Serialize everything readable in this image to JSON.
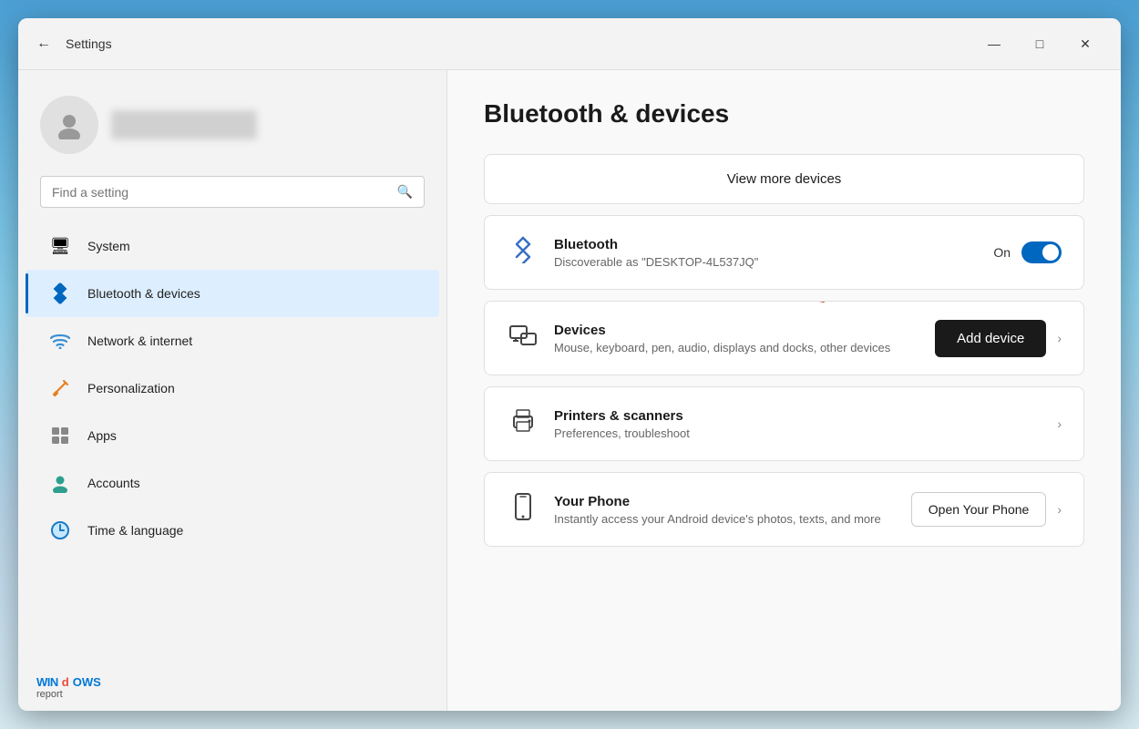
{
  "window": {
    "title": "Settings",
    "controls": {
      "minimize": "—",
      "maximize": "□",
      "close": "✕"
    }
  },
  "sidebar": {
    "search_placeholder": "Find a setting",
    "search_icon": "🔍",
    "nav_items": [
      {
        "id": "system",
        "label": "System",
        "icon": "🖥",
        "active": false
      },
      {
        "id": "bluetooth",
        "label": "Bluetooth & devices",
        "icon": "🔵",
        "active": true
      },
      {
        "id": "network",
        "label": "Network & internet",
        "icon": "📶",
        "active": false
      },
      {
        "id": "personalization",
        "label": "Personalization",
        "icon": "✏",
        "active": false
      },
      {
        "id": "apps",
        "label": "Apps",
        "icon": "📦",
        "active": false
      },
      {
        "id": "accounts",
        "label": "Accounts",
        "icon": "👤",
        "active": false
      },
      {
        "id": "time",
        "label": "Time & language",
        "icon": "🌐",
        "active": false
      }
    ]
  },
  "main": {
    "page_title": "Bluetooth & devices",
    "cards": [
      {
        "id": "view-more",
        "type": "button",
        "label": "View more devices"
      },
      {
        "id": "bluetooth",
        "type": "toggle-row",
        "icon": "bluetooth",
        "title": "Bluetooth",
        "subtitle": "Discoverable as \"DESKTOP-4L537JQ\"",
        "toggle_state": "on",
        "toggle_label": "On"
      },
      {
        "id": "devices",
        "type": "action-row",
        "icon": "devices",
        "title": "Devices",
        "subtitle": "Mouse, keyboard, pen, audio, displays and docks, other devices",
        "action_label": "Add device",
        "has_chevron": true
      },
      {
        "id": "printers",
        "type": "chevron-row",
        "icon": "printer",
        "title": "Printers & scanners",
        "subtitle": "Preferences, troubleshoot",
        "has_chevron": true
      },
      {
        "id": "yourphone",
        "type": "action-row",
        "icon": "phone",
        "title": "Your Phone",
        "subtitle": "Instantly access your Android device's photos, texts, and more",
        "action_label": "Open Your Phone",
        "has_chevron": true
      }
    ]
  },
  "annotation": {
    "arrow_color": "#cc2200"
  },
  "watermark": {
    "logo": "WINd0WS",
    "sub": "report"
  }
}
